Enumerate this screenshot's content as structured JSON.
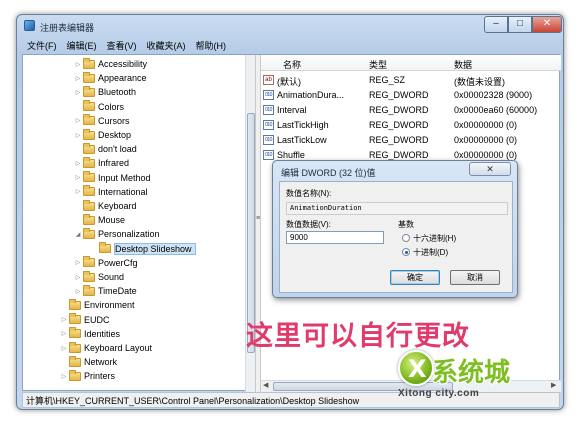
{
  "window": {
    "title": "注册表编辑器",
    "controls": {
      "minimize": "–",
      "maximize": "□",
      "close": "✕"
    }
  },
  "menu": [
    "文件(F)",
    "编辑(E)",
    "查看(V)",
    "收藏夹(A)",
    "帮助(H)"
  ],
  "tree": {
    "items": [
      {
        "label": "Accessibility",
        "expander": "▷"
      },
      {
        "label": "Appearance",
        "expander": "▷"
      },
      {
        "label": "Bluetooth",
        "expander": "▷"
      },
      {
        "label": "Colors",
        "expander": ""
      },
      {
        "label": "Cursors",
        "expander": "▷"
      },
      {
        "label": "Desktop",
        "expander": "▷"
      },
      {
        "label": "don't load",
        "expander": ""
      },
      {
        "label": "Infrared",
        "expander": "▷"
      },
      {
        "label": "Input Method",
        "expander": "▷"
      },
      {
        "label": "International",
        "expander": "▷"
      },
      {
        "label": "Keyboard",
        "expander": ""
      },
      {
        "label": "Mouse",
        "expander": ""
      },
      {
        "label": "Personalization",
        "expander": "◢"
      },
      {
        "label": "Desktop Slideshow",
        "expander": "",
        "selected": true
      },
      {
        "label": "PowerCfg",
        "expander": "▷"
      },
      {
        "label": "Sound",
        "expander": "▷"
      },
      {
        "label": "TimeDate",
        "expander": "▷"
      },
      {
        "label": "Environment",
        "expander": ""
      },
      {
        "label": "EUDC",
        "expander": "▷"
      },
      {
        "label": "Identities",
        "expander": "▷"
      },
      {
        "label": "Keyboard Layout",
        "expander": "▷"
      },
      {
        "label": "Network",
        "expander": ""
      },
      {
        "label": "Printers",
        "expander": "▷"
      }
    ]
  },
  "list": {
    "headers": {
      "name": "名称",
      "type": "类型",
      "data": "数据"
    },
    "rows": [
      {
        "icon": "ab",
        "name": "(默认)",
        "type": "REG_SZ",
        "data": "(数值未设置)"
      },
      {
        "icon": "bin",
        "name": "AnimationDura...",
        "type": "REG_DWORD",
        "data": "0x00002328 (9000)"
      },
      {
        "icon": "bin",
        "name": "Interval",
        "type": "REG_DWORD",
        "data": "0x0000ea60 (60000)"
      },
      {
        "icon": "bin",
        "name": "LastTickHigh",
        "type": "REG_DWORD",
        "data": "0x00000000 (0)"
      },
      {
        "icon": "bin",
        "name": "LastTickLow",
        "type": "REG_DWORD",
        "data": "0x00000000 (0)"
      },
      {
        "icon": "bin",
        "name": "Shuffle",
        "type": "REG_DWORD",
        "data": "0x00000000 (0)"
      }
    ]
  },
  "icons": {
    "string_value": "ab",
    "binary_value": "010"
  },
  "status_bar": "计算机\\HKEY_CURRENT_USER\\Control Panel\\Personalization\\Desktop Slideshow",
  "dialog": {
    "title": "编辑 DWORD (32 位)值",
    "close": "✕",
    "name_label": "数值名称(N):",
    "name_value": "AnimationDuration",
    "data_label": "数值数据(V):",
    "data_value": "9000",
    "base_label": "基数",
    "radio_hex": "十六进制(H)",
    "radio_dec": "十进制(D)",
    "selected_base": "decimal",
    "ok": "确定",
    "cancel": "取消"
  },
  "overlay": {
    "caption": "这里可以自行更改",
    "logo_text": "系统城",
    "logo_url": "Xitong city.com"
  }
}
